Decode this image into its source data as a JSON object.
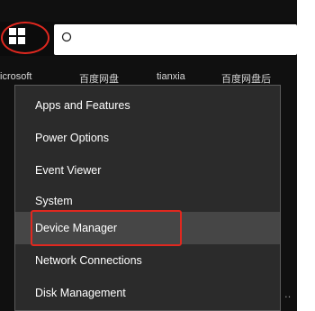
{
  "taskbar": {
    "start_icon": "windows-logo-icon",
    "search_icon": "search-icon"
  },
  "shortcuts": [
    {
      "label": "icrosoft"
    },
    {
      "label": "百度网盘"
    },
    {
      "label": "tianxia"
    },
    {
      "label": "百度网盘后"
    }
  ],
  "menu": {
    "items": [
      {
        "label": "Apps and Features"
      },
      {
        "label": "Power Options"
      },
      {
        "label": "Event Viewer"
      },
      {
        "label": "System"
      },
      {
        "label": "Device Manager"
      },
      {
        "label": "Network Connections"
      },
      {
        "label": "Disk Management"
      }
    ]
  },
  "annotations": {
    "highlight_color": "#e0281f",
    "highlighted_item": "Device Manager",
    "circled_element": "start-button"
  },
  "ellipsis": "‥"
}
